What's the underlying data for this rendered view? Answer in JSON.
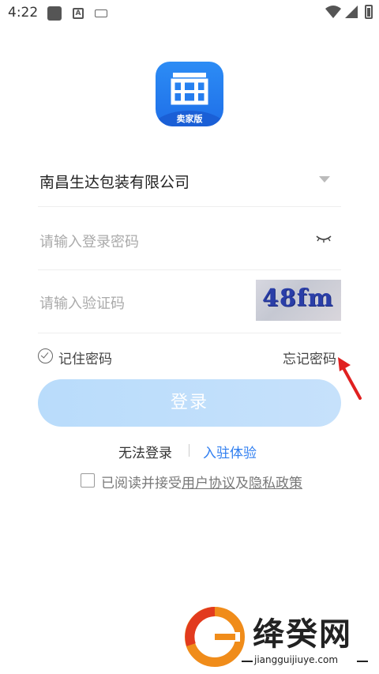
{
  "status_bar": {
    "time": "4:22",
    "icons": [
      "notification-square-icon",
      "a-icon",
      "keyboard-icon",
      "wifi-icon",
      "signal-icon",
      "battery-icon"
    ]
  },
  "logo": {
    "label": "卖家版",
    "colors": {
      "primary": "#2c8cf5",
      "dark": "#1a5fd6"
    }
  },
  "form": {
    "company": {
      "value": "南昌生达包装有限公司"
    },
    "password": {
      "placeholder": "请输入登录密码"
    },
    "captcha": {
      "placeholder": "请输入验证码",
      "image_text": "48fm"
    }
  },
  "remember": {
    "label": "记住密码"
  },
  "forgot": {
    "label": "忘记密码"
  },
  "login": {
    "label": "登录",
    "color": "#b9dcfb"
  },
  "links": {
    "cannot_login": "无法登录",
    "trial": "入驻体验",
    "trial_color": "#2f7ef0"
  },
  "agreement": {
    "prefix": "已阅读并接受",
    "user_agreement": "用户协议",
    "and": "及",
    "privacy_policy": "隐私政策"
  },
  "watermark": {
    "title": "绛癸网",
    "url": "jiangguijiuye.com"
  }
}
